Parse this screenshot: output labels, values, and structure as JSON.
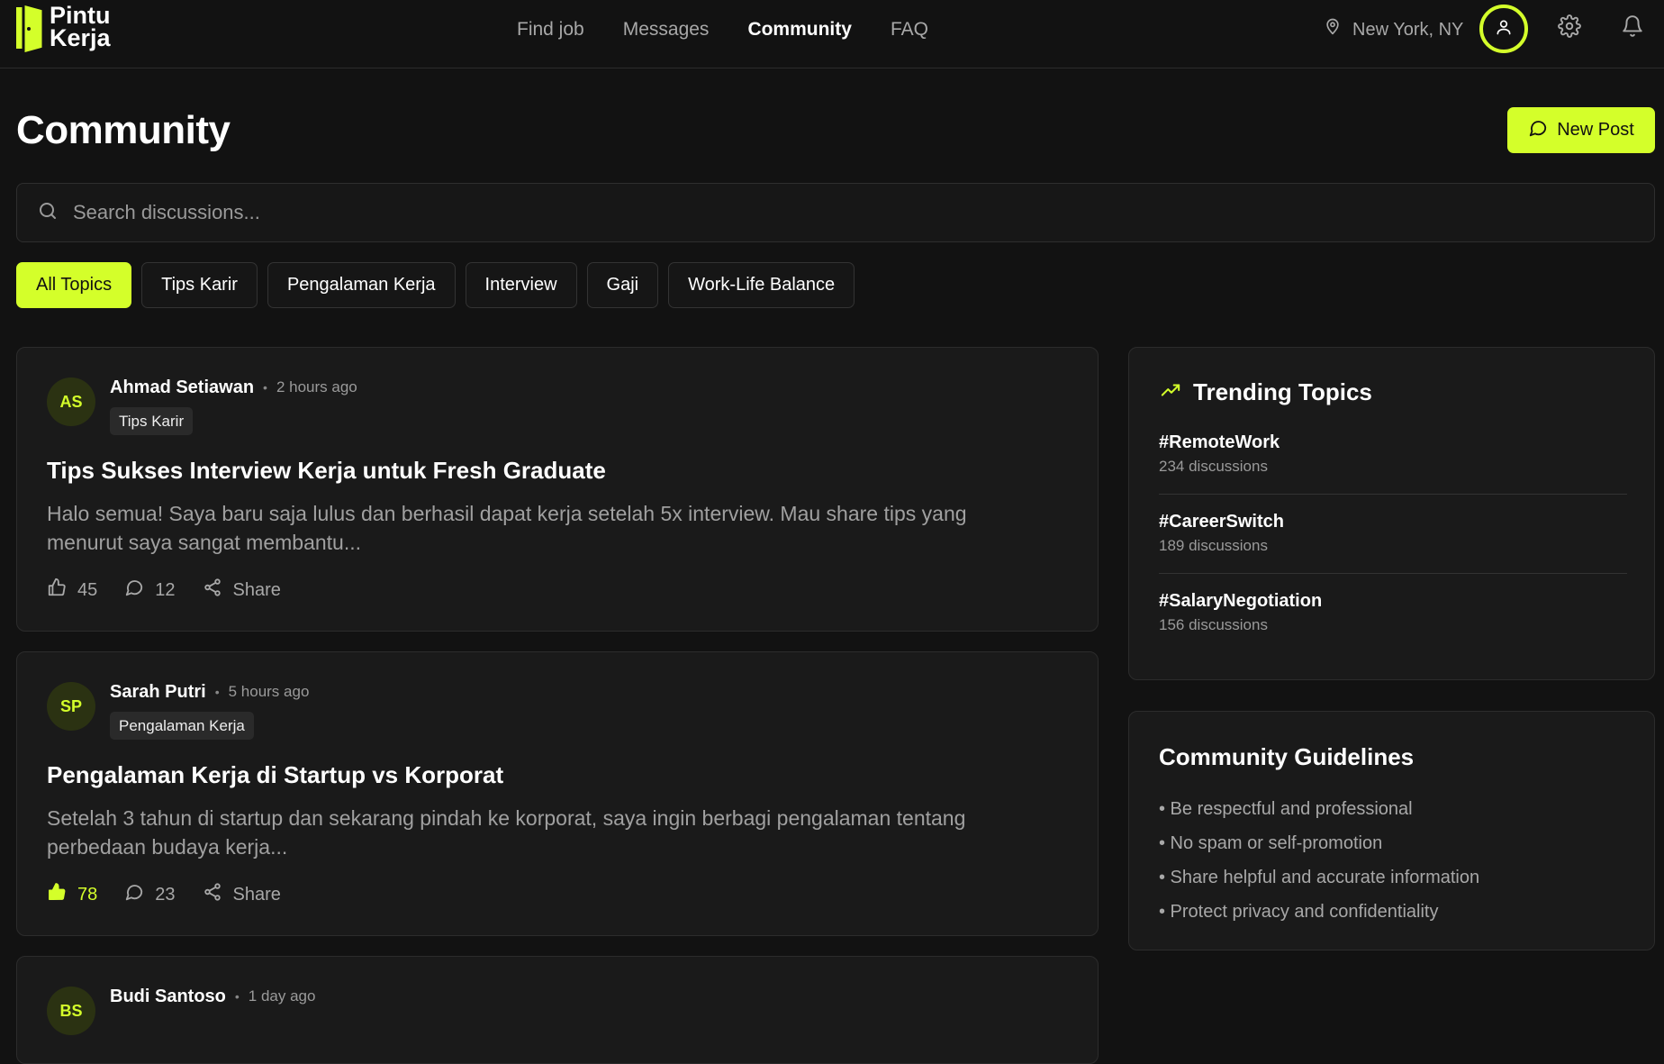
{
  "brand": {
    "name_line1": "Pintu",
    "name_line2": "Kerja",
    "accent": "#d4ff2a"
  },
  "nav": {
    "items": [
      {
        "label": "Find job"
      },
      {
        "label": "Messages"
      },
      {
        "label": "Community"
      },
      {
        "label": "FAQ"
      }
    ],
    "active": "Community"
  },
  "header": {
    "location": "New York, NY",
    "icons": [
      "location-pin-icon",
      "user-icon",
      "gear-icon",
      "bell-icon"
    ]
  },
  "page": {
    "title": "Community",
    "new_post_label": "New Post"
  },
  "search": {
    "placeholder": "Search discussions..."
  },
  "filters": {
    "items": [
      "All Topics",
      "Tips Karir",
      "Pengalaman Kerja",
      "Interview",
      "Gaji",
      "Work-Life Balance"
    ],
    "active": "All Topics"
  },
  "posts": [
    {
      "initials": "AS",
      "author": "Ahmad Setiawan",
      "time": "2 hours ago",
      "tag": "Tips Karir",
      "title": "Tips Sukses Interview Kerja untuk Fresh Graduate",
      "body_line1": "Halo semua! Saya baru saja lulus dan berhasil dapat kerja setelah 5x interview. Mau share tips yang",
      "body_line2": "menurut saya sangat membantu...",
      "likes": "45",
      "comments": "12",
      "share_label": "Share",
      "liked": false
    },
    {
      "initials": "SP",
      "author": "Sarah Putri",
      "time": "5 hours ago",
      "tag": "Pengalaman Kerja",
      "title": "Pengalaman Kerja di Startup vs Korporat",
      "body_line1": "Setelah 3 tahun di startup dan sekarang pindah ke korporat, saya ingin berbagi pengalaman tentang",
      "body_line2": "perbedaan budaya kerja...",
      "likes": "78",
      "comments": "23",
      "share_label": "Share",
      "liked": true
    },
    {
      "initials": "BS",
      "author": "Budi Santoso",
      "time": "1 day ago"
    }
  ],
  "trending": {
    "title": "Trending Topics",
    "items": [
      {
        "tag": "#RemoteWork",
        "count": "234 discussions"
      },
      {
        "tag": "#CareerSwitch",
        "count": "189 discussions"
      },
      {
        "tag": "#SalaryNegotiation",
        "count": "156 discussions"
      }
    ]
  },
  "guidelines": {
    "title": "Community Guidelines",
    "items": [
      "• Be respectful and professional",
      "• No spam or self-promotion",
      "• Share helpful and accurate information",
      "• Protect privacy and confidentiality"
    ]
  }
}
